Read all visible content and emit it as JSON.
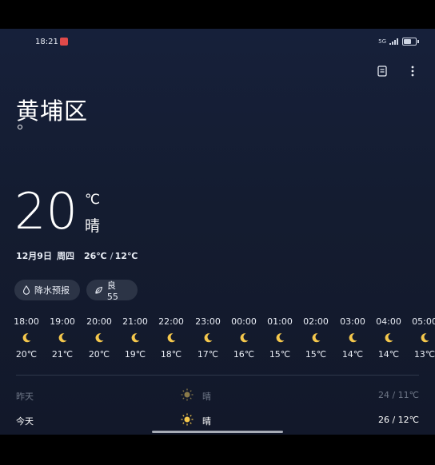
{
  "status_bar": {
    "time": "18:21",
    "notification_badge": "▇",
    "net_label": "5G"
  },
  "header": {
    "location": "黄埔区"
  },
  "current": {
    "temperature": "20",
    "unit": "℃",
    "condition": "晴",
    "date": "12月9日",
    "weekday": "周四",
    "high": "26℃",
    "separator": "/",
    "low": "12℃"
  },
  "chips": {
    "rain_forecast": "降水预报",
    "air_quality": "良 55"
  },
  "hourly": [
    {
      "time": "18:00",
      "icon": "moon-icon",
      "temp": "20℃"
    },
    {
      "time": "19:00",
      "icon": "moon-icon",
      "temp": "21℃"
    },
    {
      "time": "20:00",
      "icon": "moon-icon",
      "temp": "20℃"
    },
    {
      "time": "21:00",
      "icon": "moon-icon",
      "temp": "19℃"
    },
    {
      "time": "22:00",
      "icon": "moon-icon",
      "temp": "18℃"
    },
    {
      "time": "23:00",
      "icon": "moon-icon",
      "temp": "17℃"
    },
    {
      "time": "00:00",
      "icon": "moon-icon",
      "temp": "16℃"
    },
    {
      "time": "01:00",
      "icon": "moon-icon",
      "temp": "15℃"
    },
    {
      "time": "02:00",
      "icon": "moon-icon",
      "temp": "15℃"
    },
    {
      "time": "03:00",
      "icon": "moon-icon",
      "temp": "14℃"
    },
    {
      "time": "04:00",
      "icon": "moon-icon",
      "temp": "14℃"
    },
    {
      "time": "05:00",
      "icon": "moon-icon",
      "temp": "13℃"
    }
  ],
  "daily": [
    {
      "day": "昨天",
      "icon": "sun-icon",
      "condition": "晴",
      "range": "24 / 11℃"
    },
    {
      "day": "今天",
      "icon": "sun-icon",
      "condition": "晴",
      "range": "26 / 12℃"
    }
  ],
  "colors": {
    "background": "#141c30",
    "accent_moon": "#f5c84c",
    "sun": "#f5c84c",
    "chip": "#2c3446"
  }
}
